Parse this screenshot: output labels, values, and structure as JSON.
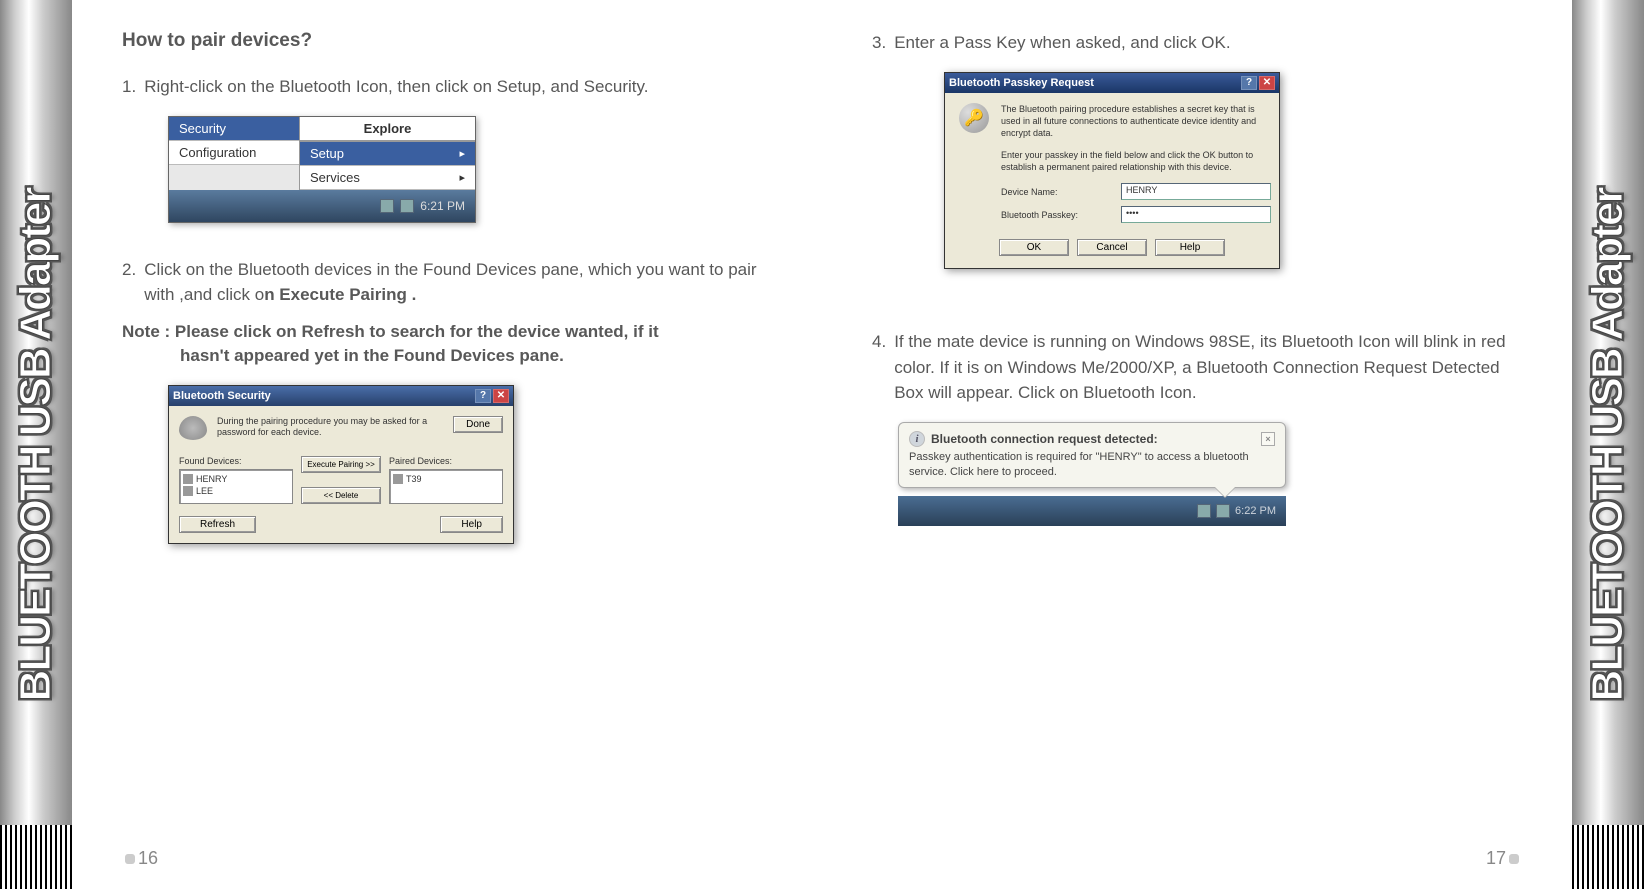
{
  "side_text": "BLUETOOTH USB Adapter",
  "left": {
    "page": "16",
    "heading": "How to pair devices?",
    "step1": {
      "num": "1.",
      "text": "Right-click on the Bluetooth Icon, then click on Setup, and Security."
    },
    "fig1": {
      "explore": "Explore",
      "security": "Security",
      "setup": "Setup",
      "configuration": "Configuration",
      "services": "Services",
      "clock": "6:21 PM"
    },
    "step2": {
      "num": "2.",
      "prefix": "Click on the Bluetooth devices in the Found Devices pane, which you want to pair with ,and click o",
      "bold": "n Execute Pairing ."
    },
    "note_label": "Note : ",
    "note_line1": "Please click on Refresh to search for the device wanted, if it",
    "note_line2": "hasn't appeared yet in the Found Devices pane.",
    "fig2": {
      "title": "Bluetooth Security",
      "help": "?",
      "close": "✕",
      "desc": "During the pairing procedure you may be asked for a password for each device.",
      "done": "Done",
      "found_label": "Found Devices:",
      "paired_label": "Paired Devices:",
      "item1": "HENRY",
      "item2": "LEE",
      "paired_item": "T39",
      "exec_btn": "Execute Pairing >>",
      "delete_btn": "<< Delete",
      "refresh": "Refresh",
      "helpbtn": "Help"
    }
  },
  "right": {
    "page": "17",
    "step3": {
      "num": "3.",
      "text": "Enter a Pass Key when asked, and click OK."
    },
    "fig3": {
      "title": "Bluetooth Passkey Request",
      "help": "?",
      "close": "✕",
      "para1": "The Bluetooth pairing procedure establishes a secret key that is used in all future connections to authenticate device identity and encrypt data.",
      "para2": "Enter your passkey in the field below and click the OK button to establish a permanent paired relationship with this device.",
      "devname_lbl": "Device Name:",
      "devname_val": "HENRY",
      "passkey_lbl": "Bluetooth Passkey:",
      "passkey_val": "••••",
      "ok": "OK",
      "cancel": "Cancel",
      "help_btn": "Help"
    },
    "step4": {
      "num": "4.",
      "text": "If the mate device is running on Windows 98SE, its Bluetooth Icon will blink in red color. If it is on Windows Me/2000/XP, a Bluetooth Connection Request Detected Box will appear. Click on Bluetooth Icon."
    },
    "fig4": {
      "heading": "Bluetooth connection request detected:",
      "body": "Passkey authentication is required for \"HENRY\" to access a bluetooth service. Click here to proceed.",
      "close": "×",
      "clock": "6:22 PM"
    }
  }
}
